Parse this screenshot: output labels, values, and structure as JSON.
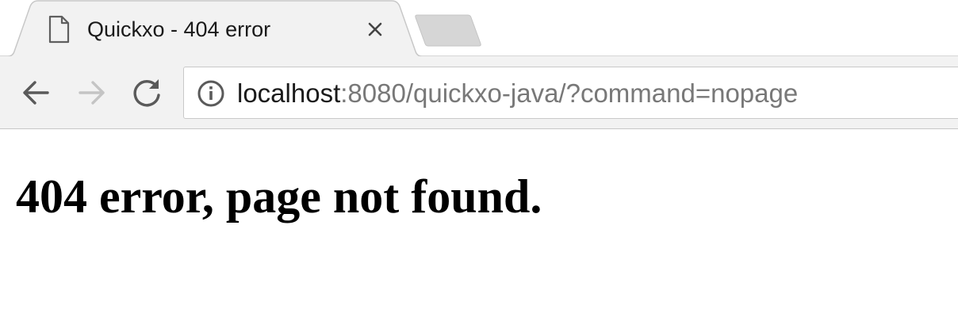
{
  "browser": {
    "tab": {
      "title": "Quickxo - 404 error",
      "icons": {
        "favicon": "document-icon",
        "close": "close-icon"
      }
    },
    "toolbar": {
      "icons": {
        "back": "arrow-left-icon",
        "forward": "arrow-right-icon",
        "reload": "reload-icon",
        "site_info": "info-icon"
      },
      "forward_enabled": false
    },
    "address_bar": {
      "host": "localhost",
      "path": ":8080/quickxo-java/?command=nopage"
    },
    "colors": {
      "tab_active_bg": "#f2f2f2",
      "tab_inactive_bg": "#d6d6d6",
      "toolbar_bg": "#f2f2f2",
      "url_host": "#1a1a1a",
      "url_path": "#787878"
    }
  },
  "page": {
    "heading": "404 error, page not found."
  }
}
